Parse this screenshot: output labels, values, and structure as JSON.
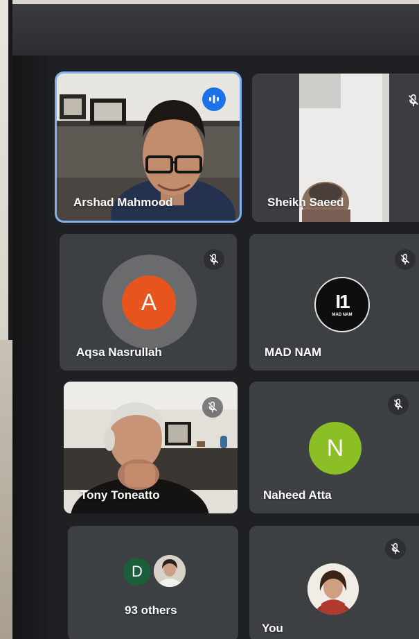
{
  "participants": [
    {
      "name": "Arshad Mahmood",
      "state": "speaking",
      "video": true
    },
    {
      "name": "Sheikh Saeed",
      "state": "muted",
      "video": true
    },
    {
      "name": "Aqsa Nasrullah",
      "state": "muted",
      "avatar_letter": "A",
      "avatar_color": "#e8541e"
    },
    {
      "name": "MAD NAM",
      "state": "muted",
      "logo_text": "MAD NAM"
    },
    {
      "name": "Tony Toneatto",
      "state": "muted",
      "video": true
    },
    {
      "name": "Naheed Atta",
      "state": "muted",
      "avatar_letter": "N",
      "avatar_color": "#8cbf26"
    }
  ],
  "others_tile": {
    "label": "93 others",
    "avatar_letter": "D",
    "avatar_color": "#1b5e3b"
  },
  "self_tile": {
    "label": "You",
    "state": "muted"
  },
  "colors": {
    "speaking_border": "#7eb2f5",
    "tile_bg": "#3c4043",
    "speaking_icon": "#1a73e8"
  }
}
